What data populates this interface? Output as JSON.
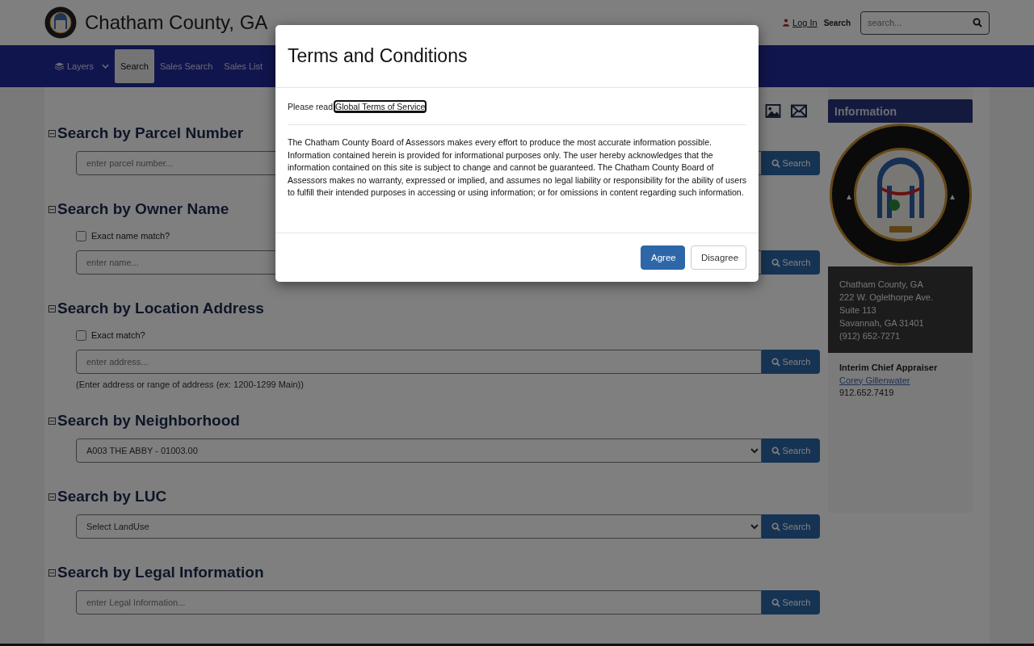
{
  "header": {
    "title": "Chatham County, GA",
    "login": "Log In",
    "search_label": "Search",
    "search_placeholder": "search..."
  },
  "nav": [
    {
      "label": "Layers",
      "kind": "dropdown",
      "selected": false
    },
    {
      "label": "Search",
      "kind": "link",
      "selected": true
    },
    {
      "label": "Sales Search",
      "kind": "link",
      "selected": false
    },
    {
      "label": "Sales List",
      "kind": "link",
      "selected": false
    }
  ],
  "sections": [
    {
      "title": "Search by Parcel Number",
      "kind": "text",
      "placeholder": "enter parcel number...",
      "button": "Search"
    },
    {
      "title": "Search by Owner Name",
      "kind": "text",
      "checkbox": {
        "label": "Exact name match?",
        "checked": false
      },
      "placeholder": "enter name...",
      "button": "Search"
    },
    {
      "title": "Search by Location Address",
      "kind": "text",
      "checkbox": {
        "label": "Exact match?",
        "checked": false
      },
      "placeholder": "enter address...",
      "hint": "(Enter address or range of address (ex: 1200-1299 Main))",
      "button": "Search"
    },
    {
      "title": "Search by Neighborhood",
      "kind": "select",
      "value": "A003 THE ABBY - 01003.00",
      "button": "Search"
    },
    {
      "title": "Search by LUC",
      "kind": "select",
      "value": "Select LandUse",
      "button": "Search"
    },
    {
      "title": "Search by Legal Information",
      "kind": "text",
      "placeholder": "enter Legal Information...",
      "button": "Search"
    }
  ],
  "sidebar": {
    "heading": "Information",
    "address_lines": [
      "Chatham County, GA",
      "222 W. Oglethorpe Ave.",
      "Suite 113",
      "Savannah, GA 31401",
      "(912) 652-7271"
    ],
    "appraiser_title": "Interim Chief Appraiser",
    "appraiser_name": "Corey Gillenwater",
    "appraiser_phone": "912.652.7419"
  },
  "modal": {
    "title": "Terms and Conditions",
    "intro": "Please read",
    "link": "Global Terms of Service",
    "body": "The Chatham County Board of Assessors makes every effort to produce the most accurate information possible. Information contained herein is provided for informational purposes only. The user hereby acknowledges that the information contained on this site is subject to change and cannot be guaranteed. The Chatham County Board of Assessors makes no warranty, expressed or implied, and assumes no legal liability or responsibility for the ability of users to fulfill their intended purposes in accessing or using information; or for omissions in content regarding such information.",
    "buttons": [
      {
        "label": "Agree",
        "kind": "primary"
      },
      {
        "label": "Disagree",
        "kind": "default"
      }
    ]
  }
}
